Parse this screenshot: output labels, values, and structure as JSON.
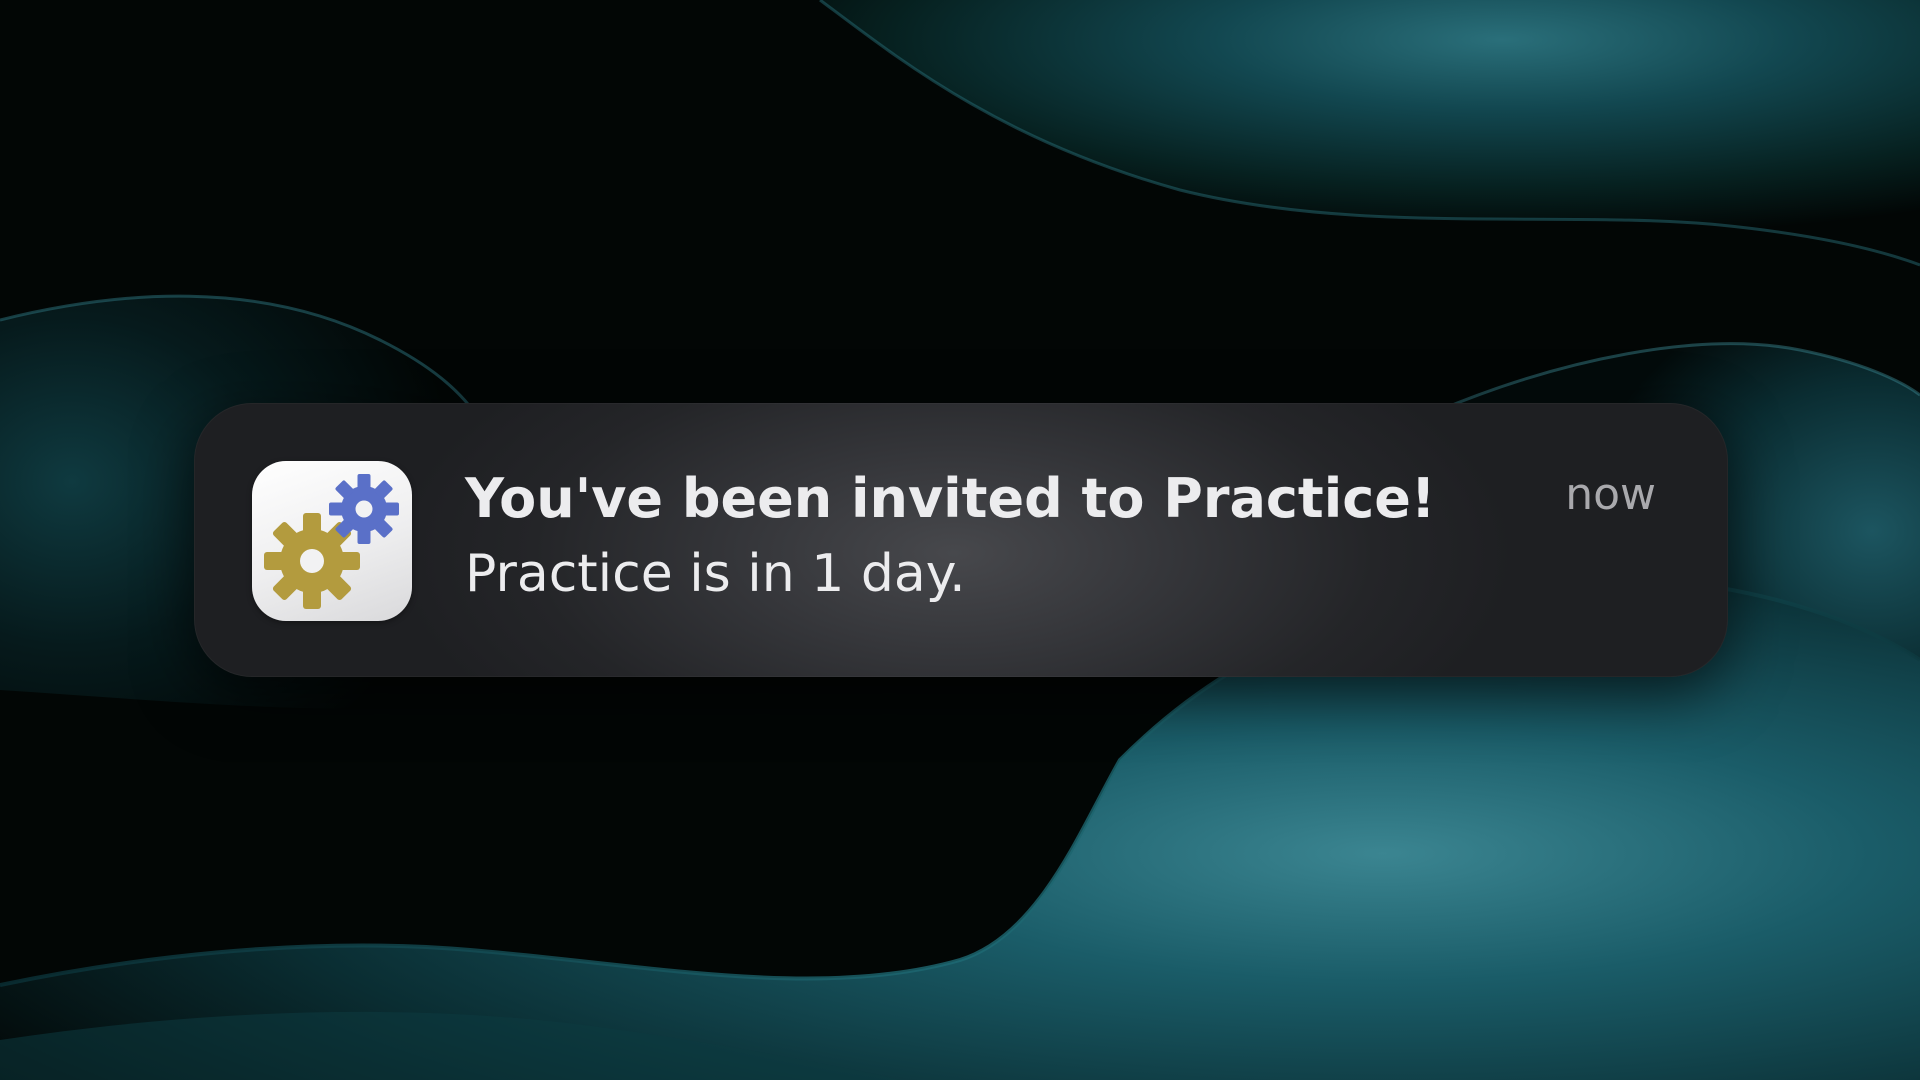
{
  "notification": {
    "title": "You've been invited to Practice!",
    "body": "Practice is in 1 day.",
    "timestamp": "now",
    "app_icon": "gears-icon"
  },
  "colors": {
    "wallpaper_base": "#020605",
    "wallpaper_wave": "#0f4a55",
    "card_background": "#2c2d30",
    "title_text": "#ececee",
    "timestamp_text": "#a9a9ad",
    "gear_gold": "#b39b3e",
    "gear_blue": "#5a70c8"
  }
}
